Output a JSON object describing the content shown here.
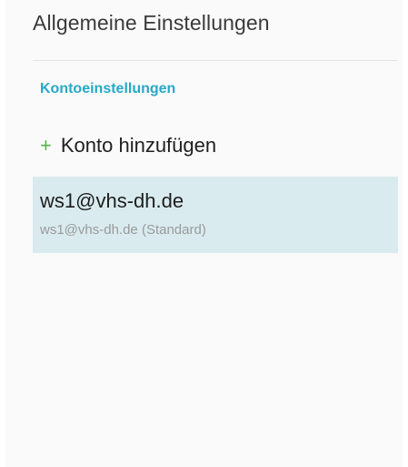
{
  "settings": {
    "general_label": "Allgemeine Einstellungen",
    "account_section_header": "Kontoeinstellungen",
    "add_account": {
      "icon": "plus-icon",
      "symbol": "+",
      "label": "Konto hinzufügen"
    },
    "accounts": [
      {
        "name": "ws1@vhs-dh.de",
        "subtitle": "ws1@vhs-dh.de (Standard)",
        "selected": true
      }
    ]
  },
  "colors": {
    "accent": "#27a9c6",
    "plus": "#5bb04e",
    "selected_row_bg": "#d9ebef"
  }
}
